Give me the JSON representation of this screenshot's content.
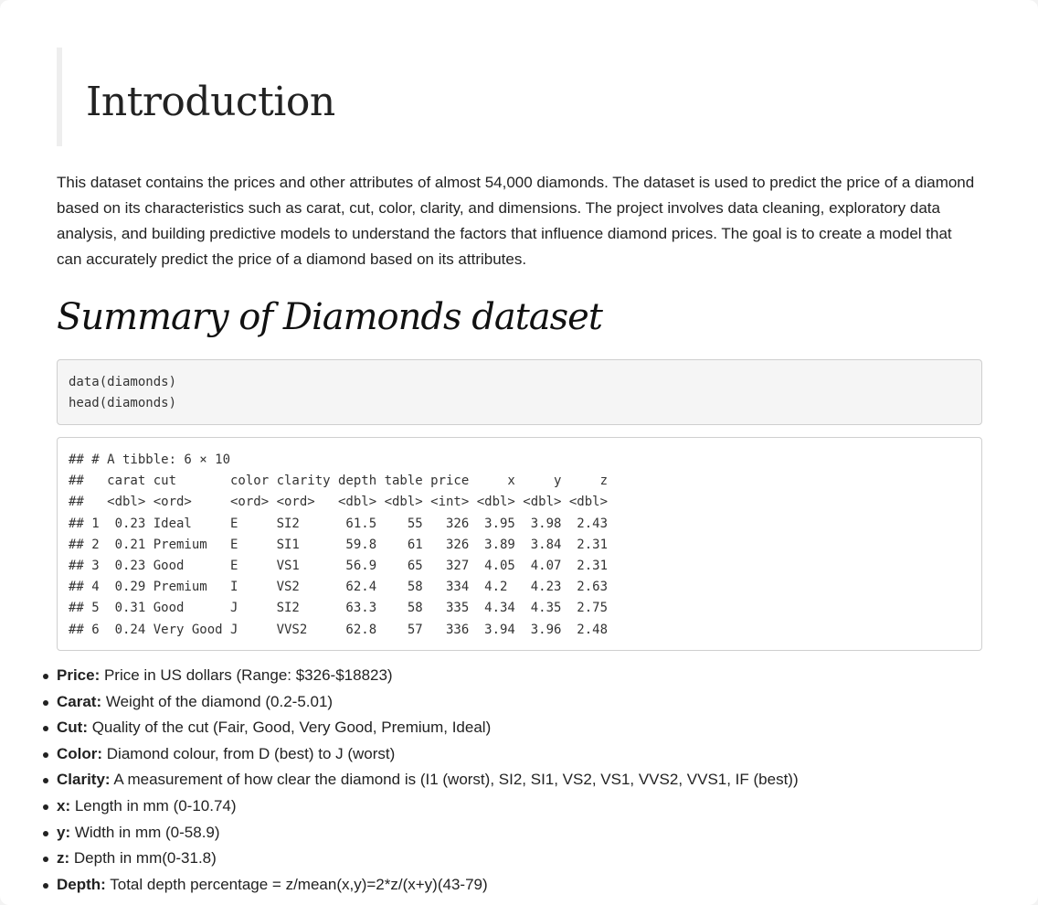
{
  "title": "Introduction",
  "intro": "This dataset contains the prices and other attributes of almost 54,000 diamonds. The dataset is used to predict the price of a diamond based on its characteristics such as carat, cut, color, clarity, and dimensions. The project involves data cleaning, exploratory data analysis, and building predictive models to understand the factors that influence diamond prices. The goal is to create a model that can accurately predict the price of a diamond based on its attributes.",
  "section_title": "Summary of Diamonds dataset",
  "code_source": [
    "data(diamonds)",
    "head(diamonds)"
  ],
  "code_output": [
    "## # A tibble: 6 × 10",
    "##   carat cut       color clarity depth table price     x     y     z",
    "##   <dbl> <ord>     <ord> <ord>   <dbl> <dbl> <int> <dbl> <dbl> <dbl>",
    "## 1  0.23 Ideal     E     SI2      61.5    55   326  3.95  3.98  2.43",
    "## 2  0.21 Premium   E     SI1      59.8    61   326  3.89  3.84  2.31",
    "## 3  0.23 Good      E     VS1      56.9    65   327  4.05  4.07  2.31",
    "## 4  0.29 Premium   I     VS2      62.4    58   334  4.2   4.23  2.63",
    "## 5  0.31 Good      J     SI2      63.3    58   335  4.34  4.35  2.75",
    "## 6  0.24 Very Good J     VVS2     62.8    57   336  3.94  3.96  2.48"
  ],
  "attributes": [
    {
      "name": "Price:",
      "desc": " Price in US dollars (Range: $326-$18823)"
    },
    {
      "name": "Carat:",
      "desc": " Weight of the diamond (0.2-5.01)"
    },
    {
      "name": "Cut:",
      "desc": " Quality of the cut (Fair, Good, Very Good, Premium, Ideal)"
    },
    {
      "name": "Color:",
      "desc": " Diamond colour, from D (best) to J (worst)"
    },
    {
      "name": "Clarity:",
      "desc": " A measurement of how clear the diamond is (I1 (worst), SI2, SI1, VS2, VS1, VVS2, VVS1, IF (best))"
    },
    {
      "name": "x:",
      "desc": " Length in mm (0-10.74)"
    },
    {
      "name": "y:",
      "desc": " Width in mm (0-58.9)"
    },
    {
      "name": "z:",
      "desc": " Depth in mm(0-31.8)"
    },
    {
      "name": "Depth:",
      "desc": " Total depth percentage = z/mean(x,y)=2*z/(x+y)(43-79)"
    }
  ]
}
